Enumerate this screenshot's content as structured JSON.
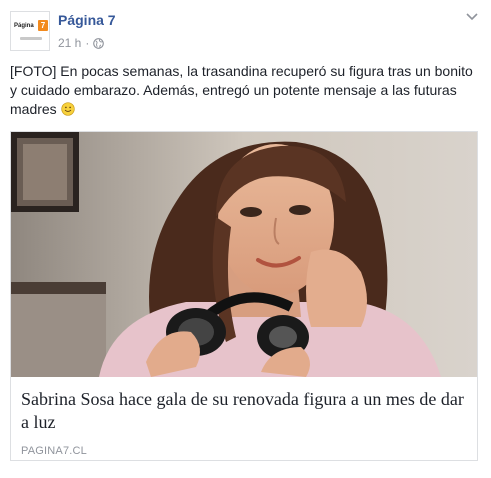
{
  "post": {
    "page_name": "Página 7",
    "time": "21 h",
    "separator": "·",
    "privacy_icon": "globe-icon",
    "menu_icon": "chevron-down-icon",
    "avatar": {
      "logo_text": "Página",
      "logo_badge": "7"
    },
    "text": "[FOTO] En pocas semanas, la trasandina Sabrina Sosa recuperó su figura tras un bonito y cuidado embarazo. Además, entregó un potente mensaje a las futuras madres",
    "text_display": "[FOTO] En pocas semanas, la trasandina recuperó su figura tras un bonito y cuidado embarazo. Además, entregó un potente mensaje a las futuras madres",
    "emoji": "smile-emoji"
  },
  "link_card": {
    "image": "woman-with-headphones-photo",
    "title": "Sabrina Sosa hace gala de su renovada figura a un mes de dar a luz",
    "domain": "PAGINA7.CL"
  },
  "colors": {
    "name_link": "#365899",
    "meta": "#90949c",
    "text": "#1d2129",
    "border": "#dddfe2"
  }
}
